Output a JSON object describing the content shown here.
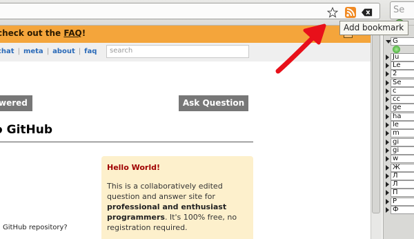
{
  "browser": {
    "tooltip": "Add bookmark",
    "search_placeholder": "Se",
    "icons": [
      "bookmark-star-icon",
      "rss-feed-icon",
      "clear-url-icon"
    ]
  },
  "notice": {
    "text": "check out the ",
    "link": "FAQ",
    "suffix": "!",
    "close": "x"
  },
  "nav": {
    "links": [
      "chat",
      "meta",
      "about",
      "faq"
    ],
    "search_placeholder": "search"
  },
  "buttons": {
    "answered": "wered",
    "ask": "Ask Question"
  },
  "title": "GitHub",
  "question_snippet": "GitHub repository?",
  "hello": {
    "title": "Hello World!",
    "line1": "This is a collaboratively edited question and answer site for ",
    "bold": "professional and enthusiast programmers",
    "line2": ". It's 100% free, no registration required."
  },
  "side_panel": {
    "items": [
      "G",
      "Ju",
      "Le",
      "2",
      "Se",
      "c",
      "cc",
      "ge",
      "ha",
      "le",
      "m",
      "gi",
      "gi",
      "w",
      "Ж",
      "Л",
      "Л",
      "П",
      "Р",
      "Ф"
    ]
  },
  "colors": {
    "notice_bg": "#f4a53b",
    "button_bg": "#777777",
    "hello_bg": "#fdf0cc",
    "hello_title": "#a00000",
    "link": "#2a6ab8",
    "annotation_arrow": "#e8101a"
  }
}
